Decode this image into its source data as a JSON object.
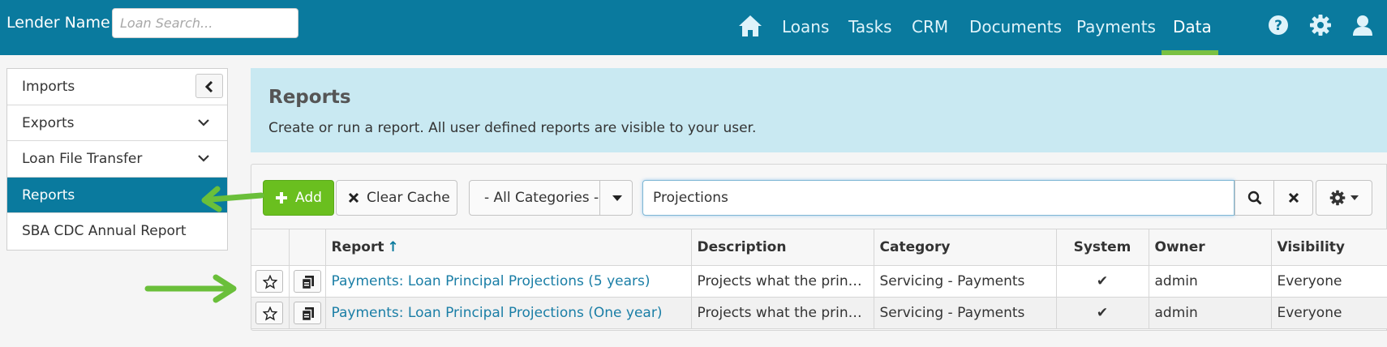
{
  "topbar": {
    "brand": "Lender Name",
    "search_placeholder": "Loan Search...",
    "nav": [
      "Loans",
      "Tasks",
      "CRM",
      "Documents",
      "Payments",
      "Data"
    ],
    "active_nav": "Data",
    "icons": [
      "home-icon",
      "help-icon",
      "gear-icon",
      "user-icon"
    ]
  },
  "sidebar": {
    "items": [
      {
        "label": "Imports"
      },
      {
        "label": "Exports"
      },
      {
        "label": "Loan File Transfer"
      },
      {
        "label": "Reports"
      },
      {
        "label": "SBA CDC Annual Report"
      }
    ],
    "active": "Reports"
  },
  "banner": {
    "title": "Reports",
    "subtitle": "Create or run a report. All user defined reports are visible to your user."
  },
  "toolbar": {
    "add_label": "Add",
    "clear_label": "Clear Cache",
    "category_value": "- All Categories -",
    "search_value": "Projections"
  },
  "table": {
    "columns": [
      "Report",
      "Description",
      "Category",
      "System",
      "Owner",
      "Visibility"
    ],
    "sort_indicator": "↑",
    "rows": [
      {
        "report": "Payments: Loan Principal Projections (5 years)",
        "description": "Projects what the princip...",
        "category": "Servicing - Payments",
        "system": "✔",
        "owner": "admin",
        "visibility": "Everyone"
      },
      {
        "report": "Payments: Loan Principal Projections (One year)",
        "description": "Projects what the princip...",
        "category": "Servicing - Payments",
        "system": "✔",
        "owner": "admin",
        "visibility": "Everyone"
      }
    ]
  },
  "colors": {
    "header": "#0a7a9e",
    "active_underline": "#7ac142",
    "add_button": "#6abf1f",
    "banner": "#c9e9f2",
    "annotation_arrow": "#6abf3a"
  }
}
